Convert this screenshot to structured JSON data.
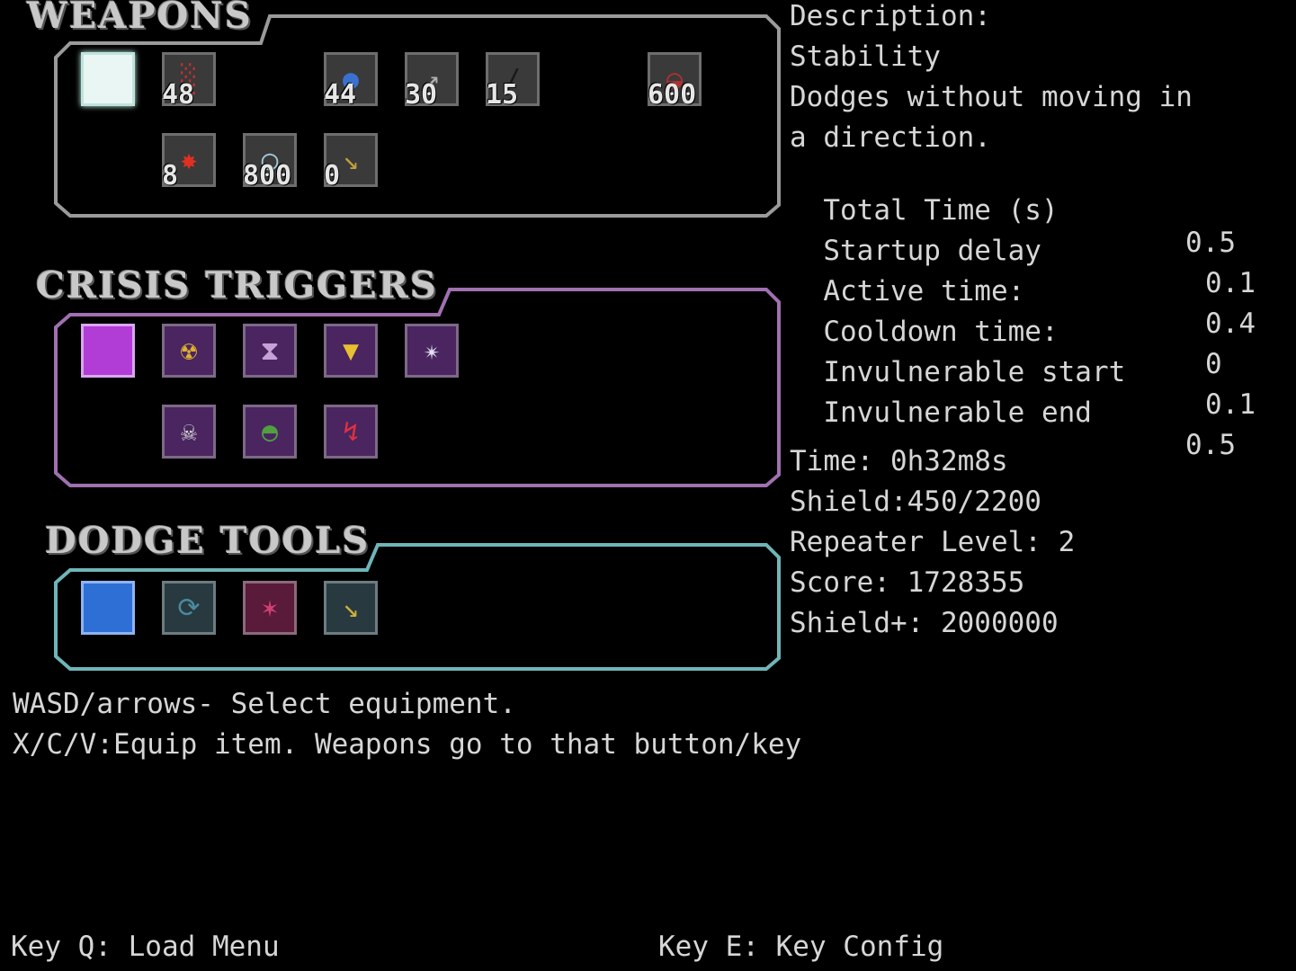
{
  "sections": {
    "weapons": {
      "title": "WEAPONS",
      "color": "#9a9a9a"
    },
    "crisis": {
      "title": "CRISIS TRIGGERS",
      "color": "#a070b0"
    },
    "dodge": {
      "title": "DODGE TOOLS",
      "color": "#6fb5b8"
    }
  },
  "weapons": {
    "row1": [
      {
        "icon": "blank-selected-icon",
        "count": ""
      },
      {
        "icon": "bar-burst-icon",
        "count": "48"
      },
      {
        "icon": "blue-orbs-icon",
        "count": "44"
      },
      {
        "icon": "arrow-icon",
        "count": "30"
      },
      {
        "icon": "blade-icon",
        "count": "15"
      },
      {
        "icon": "red-dome-icon",
        "count": "600"
      }
    ],
    "row2": [
      {
        "icon": "fire-star-icon",
        "count": "8"
      },
      {
        "icon": "ring-icon",
        "count": "800"
      },
      {
        "icon": "rocket-icon",
        "count": "0"
      }
    ]
  },
  "crisis_triggers": {
    "row1": [
      "blank-selected-icon",
      "radiation-icon",
      "hourglass-icon",
      "shield-icon",
      "star-burst-icon"
    ],
    "row2": [
      "skull-icon",
      "helmet-icon",
      "lightning-icon"
    ]
  },
  "dodge_tools": [
    "blank-selected-icon",
    "swirl-icon",
    "wing-icon",
    "drill-icon"
  ],
  "description": {
    "header": "Description:",
    "name": "Stability",
    "text_line1": "Dodges without moving in",
    "text_line2": "a direction.",
    "stats": [
      {
        "label": "Total Time (s)",
        "value": "0.5"
      },
      {
        "label": "Startup delay",
        "value": "0.1"
      },
      {
        "label": "Active time:",
        "value": "0.4"
      },
      {
        "label": "Cooldown time:",
        "value": "0"
      },
      {
        "label": "Invulnerable start",
        "value": "0.1"
      },
      {
        "label": "Invulnerable end",
        "value": "0.5"
      }
    ]
  },
  "status": {
    "time": "Time: 0h32m8s",
    "shield": "Shield:450/2200",
    "repeater": "Repeater Level: 2",
    "score": "Score: 1728355",
    "shield_plus": "Shield+: 2000000"
  },
  "help": {
    "line1": "WASD/arrows- Select equipment.",
    "line2": "X/C/V:Equip item. Weapons go to that button/key"
  },
  "footer": {
    "load_menu": "Key Q: Load Menu",
    "key_config": "Key E: Key Config"
  }
}
